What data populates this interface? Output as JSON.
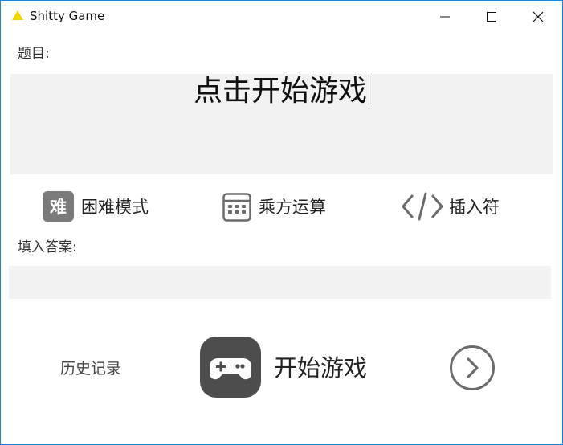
{
  "window": {
    "title": "Shitty Game",
    "app_icon": "yellow-triangle-icon",
    "controls": {
      "minimize": "minimize-icon",
      "maximize": "maximize-icon",
      "close": "close-icon"
    },
    "border_color": "#1883d7"
  },
  "question": {
    "label": "题目:",
    "text": "点击开始游戏"
  },
  "options": [
    {
      "label": "困难模式",
      "icon": "hard-mode-icon",
      "icon_glyph": "难"
    },
    {
      "label": "乘方运算",
      "icon": "calculator-icon"
    },
    {
      "label": "插入符",
      "icon": "code-brackets-icon"
    }
  ],
  "answer": {
    "label": "填入答案:",
    "value": "",
    "placeholder": ""
  },
  "footer": {
    "history_label": "历史记录",
    "start_label": "开始游戏",
    "start_icon": "gamepad-icon",
    "next_icon": "chevron-right-circle-icon"
  },
  "colors": {
    "panel_bg": "#f2f2f2",
    "icon_gray": "#6b6b6b",
    "accent_yellow": "#f2d600"
  }
}
